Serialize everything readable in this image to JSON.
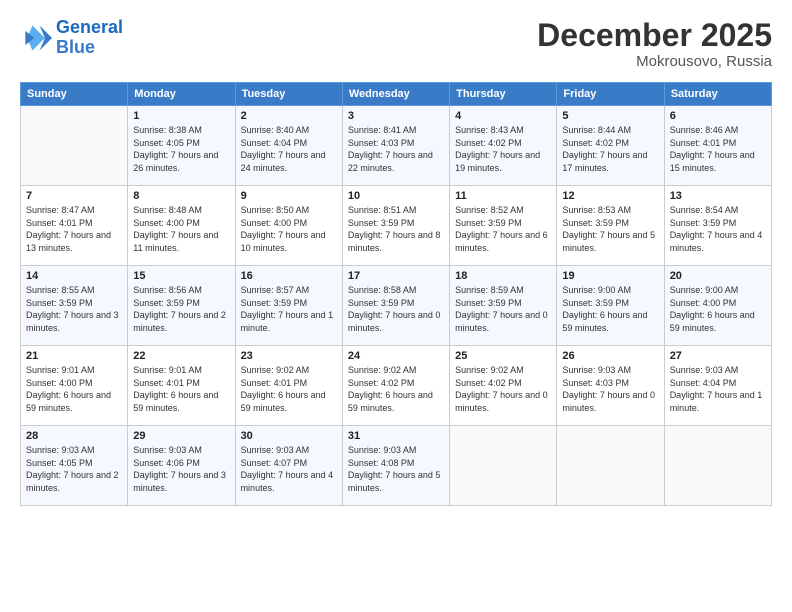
{
  "header": {
    "logo_line1": "General",
    "logo_line2": "Blue",
    "month_title": "December 2025",
    "location": "Mokrousovo, Russia"
  },
  "days_of_week": [
    "Sunday",
    "Monday",
    "Tuesday",
    "Wednesday",
    "Thursday",
    "Friday",
    "Saturday"
  ],
  "weeks": [
    [
      {
        "num": "",
        "sunrise": "",
        "sunset": "",
        "daylight": ""
      },
      {
        "num": "1",
        "sunrise": "Sunrise: 8:38 AM",
        "sunset": "Sunset: 4:05 PM",
        "daylight": "Daylight: 7 hours and 26 minutes."
      },
      {
        "num": "2",
        "sunrise": "Sunrise: 8:40 AM",
        "sunset": "Sunset: 4:04 PM",
        "daylight": "Daylight: 7 hours and 24 minutes."
      },
      {
        "num": "3",
        "sunrise": "Sunrise: 8:41 AM",
        "sunset": "Sunset: 4:03 PM",
        "daylight": "Daylight: 7 hours and 22 minutes."
      },
      {
        "num": "4",
        "sunrise": "Sunrise: 8:43 AM",
        "sunset": "Sunset: 4:02 PM",
        "daylight": "Daylight: 7 hours and 19 minutes."
      },
      {
        "num": "5",
        "sunrise": "Sunrise: 8:44 AM",
        "sunset": "Sunset: 4:02 PM",
        "daylight": "Daylight: 7 hours and 17 minutes."
      },
      {
        "num": "6",
        "sunrise": "Sunrise: 8:46 AM",
        "sunset": "Sunset: 4:01 PM",
        "daylight": "Daylight: 7 hours and 15 minutes."
      }
    ],
    [
      {
        "num": "7",
        "sunrise": "Sunrise: 8:47 AM",
        "sunset": "Sunset: 4:01 PM",
        "daylight": "Daylight: 7 hours and 13 minutes."
      },
      {
        "num": "8",
        "sunrise": "Sunrise: 8:48 AM",
        "sunset": "Sunset: 4:00 PM",
        "daylight": "Daylight: 7 hours and 11 minutes."
      },
      {
        "num": "9",
        "sunrise": "Sunrise: 8:50 AM",
        "sunset": "Sunset: 4:00 PM",
        "daylight": "Daylight: 7 hours and 10 minutes."
      },
      {
        "num": "10",
        "sunrise": "Sunrise: 8:51 AM",
        "sunset": "Sunset: 3:59 PM",
        "daylight": "Daylight: 7 hours and 8 minutes."
      },
      {
        "num": "11",
        "sunrise": "Sunrise: 8:52 AM",
        "sunset": "Sunset: 3:59 PM",
        "daylight": "Daylight: 7 hours and 6 minutes."
      },
      {
        "num": "12",
        "sunrise": "Sunrise: 8:53 AM",
        "sunset": "Sunset: 3:59 PM",
        "daylight": "Daylight: 7 hours and 5 minutes."
      },
      {
        "num": "13",
        "sunrise": "Sunrise: 8:54 AM",
        "sunset": "Sunset: 3:59 PM",
        "daylight": "Daylight: 7 hours and 4 minutes."
      }
    ],
    [
      {
        "num": "14",
        "sunrise": "Sunrise: 8:55 AM",
        "sunset": "Sunset: 3:59 PM",
        "daylight": "Daylight: 7 hours and 3 minutes."
      },
      {
        "num": "15",
        "sunrise": "Sunrise: 8:56 AM",
        "sunset": "Sunset: 3:59 PM",
        "daylight": "Daylight: 7 hours and 2 minutes."
      },
      {
        "num": "16",
        "sunrise": "Sunrise: 8:57 AM",
        "sunset": "Sunset: 3:59 PM",
        "daylight": "Daylight: 7 hours and 1 minute."
      },
      {
        "num": "17",
        "sunrise": "Sunrise: 8:58 AM",
        "sunset": "Sunset: 3:59 PM",
        "daylight": "Daylight: 7 hours and 0 minutes."
      },
      {
        "num": "18",
        "sunrise": "Sunrise: 8:59 AM",
        "sunset": "Sunset: 3:59 PM",
        "daylight": "Daylight: 7 hours and 0 minutes."
      },
      {
        "num": "19",
        "sunrise": "Sunrise: 9:00 AM",
        "sunset": "Sunset: 3:59 PM",
        "daylight": "Daylight: 6 hours and 59 minutes."
      },
      {
        "num": "20",
        "sunrise": "Sunrise: 9:00 AM",
        "sunset": "Sunset: 4:00 PM",
        "daylight": "Daylight: 6 hours and 59 minutes."
      }
    ],
    [
      {
        "num": "21",
        "sunrise": "Sunrise: 9:01 AM",
        "sunset": "Sunset: 4:00 PM",
        "daylight": "Daylight: 6 hours and 59 minutes."
      },
      {
        "num": "22",
        "sunrise": "Sunrise: 9:01 AM",
        "sunset": "Sunset: 4:01 PM",
        "daylight": "Daylight: 6 hours and 59 minutes."
      },
      {
        "num": "23",
        "sunrise": "Sunrise: 9:02 AM",
        "sunset": "Sunset: 4:01 PM",
        "daylight": "Daylight: 6 hours and 59 minutes."
      },
      {
        "num": "24",
        "sunrise": "Sunrise: 9:02 AM",
        "sunset": "Sunset: 4:02 PM",
        "daylight": "Daylight: 6 hours and 59 minutes."
      },
      {
        "num": "25",
        "sunrise": "Sunrise: 9:02 AM",
        "sunset": "Sunset: 4:02 PM",
        "daylight": "Daylight: 7 hours and 0 minutes."
      },
      {
        "num": "26",
        "sunrise": "Sunrise: 9:03 AM",
        "sunset": "Sunset: 4:03 PM",
        "daylight": "Daylight: 7 hours and 0 minutes."
      },
      {
        "num": "27",
        "sunrise": "Sunrise: 9:03 AM",
        "sunset": "Sunset: 4:04 PM",
        "daylight": "Daylight: 7 hours and 1 minute."
      }
    ],
    [
      {
        "num": "28",
        "sunrise": "Sunrise: 9:03 AM",
        "sunset": "Sunset: 4:05 PM",
        "daylight": "Daylight: 7 hours and 2 minutes."
      },
      {
        "num": "29",
        "sunrise": "Sunrise: 9:03 AM",
        "sunset": "Sunset: 4:06 PM",
        "daylight": "Daylight: 7 hours and 3 minutes."
      },
      {
        "num": "30",
        "sunrise": "Sunrise: 9:03 AM",
        "sunset": "Sunset: 4:07 PM",
        "daylight": "Daylight: 7 hours and 4 minutes."
      },
      {
        "num": "31",
        "sunrise": "Sunrise: 9:03 AM",
        "sunset": "Sunset: 4:08 PM",
        "daylight": "Daylight: 7 hours and 5 minutes."
      },
      {
        "num": "",
        "sunrise": "",
        "sunset": "",
        "daylight": ""
      },
      {
        "num": "",
        "sunrise": "",
        "sunset": "",
        "daylight": ""
      },
      {
        "num": "",
        "sunrise": "",
        "sunset": "",
        "daylight": ""
      }
    ]
  ]
}
